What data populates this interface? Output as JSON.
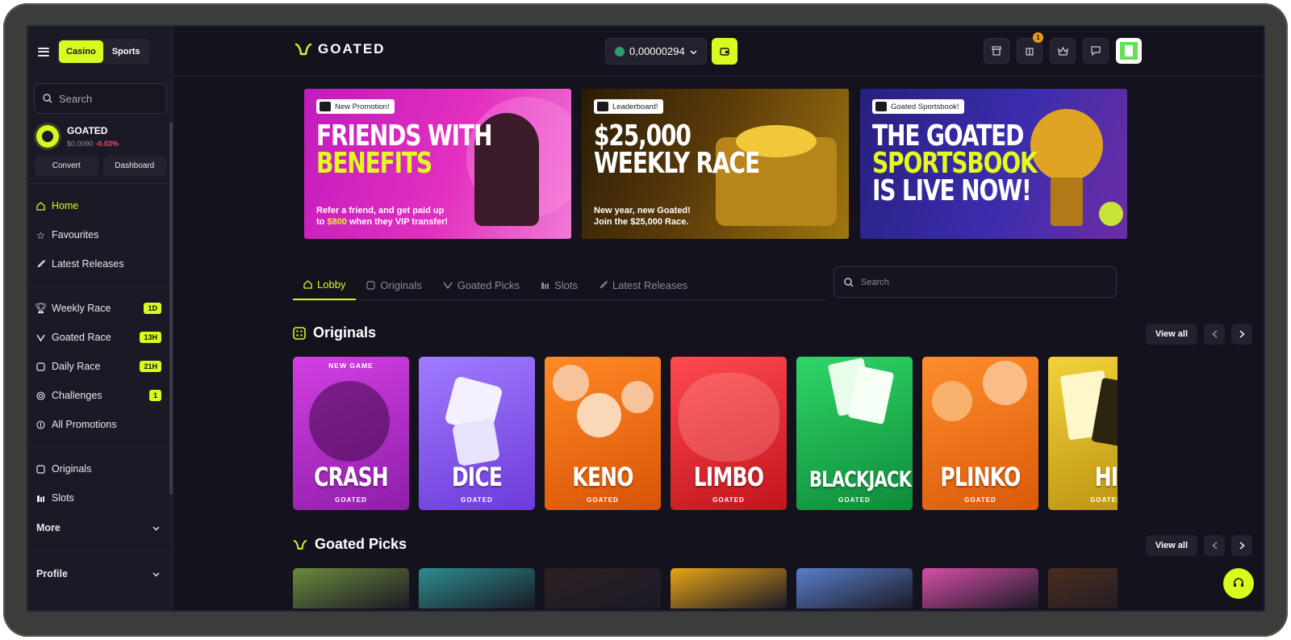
{
  "app": {
    "brand": "GOATED"
  },
  "sidebar": {
    "modes": [
      "Casino",
      "Sports"
    ],
    "search_placeholder": "Search",
    "token": {
      "name": "GOATED",
      "price": "$0.0090",
      "change": "-0.03%"
    },
    "token_actions": [
      "Convert",
      "Dashboard"
    ],
    "nav_main": [
      {
        "label": "Home",
        "icon": "home-icon"
      },
      {
        "label": "Favourites",
        "icon": "star-icon"
      },
      {
        "label": "Latest Releases",
        "icon": "rocket-icon"
      }
    ],
    "nav_races": [
      {
        "label": "Weekly Race",
        "badge": "1D",
        "icon": "trophy-icon"
      },
      {
        "label": "Goated Race",
        "badge": "13H",
        "icon": "goated-logo-icon"
      },
      {
        "label": "Daily Race",
        "badge": "21H",
        "icon": "square-icon"
      },
      {
        "label": "Challenges",
        "badge": "1",
        "icon": "target-icon"
      },
      {
        "label": "All Promotions",
        "badge": "",
        "icon": "coin-icon"
      }
    ],
    "nav_games": [
      {
        "label": "Originals",
        "icon": "square-icon"
      },
      {
        "label": "Slots",
        "icon": "slots-icon"
      }
    ],
    "more_label": "More",
    "profile_label": "Profile"
  },
  "header": {
    "balance": "0,00000294",
    "notification_count": "1"
  },
  "banners": [
    {
      "tag": "New Promotion!",
      "head_line1": "FRIENDS WITH",
      "head_line2": "BENEFITS",
      "sub_line1": "Refer a friend, and get paid up",
      "sub_pre": "to ",
      "sub_amount": "$800",
      "sub_post": " when they VIP transfer!"
    },
    {
      "tag": "Leaderboard!",
      "head_line1": "$25,000",
      "head_line2": "WEEKLY RACE",
      "sub_line1": "New year, new Goated!",
      "sub_line2": "Join the $25,000 Race."
    },
    {
      "tag": "Goated Sportsbook!",
      "head_line1": "THE GOATED",
      "head_line2": "SPORTSBOOK",
      "head_line3": "IS LIVE NOW!"
    }
  ],
  "tabs": [
    {
      "label": "Lobby",
      "icon": "home-icon"
    },
    {
      "label": "Originals",
      "icon": "square-icon"
    },
    {
      "label": "Goated Picks",
      "icon": "goated-logo-icon"
    },
    {
      "label": "Slots",
      "icon": "slots-icon"
    },
    {
      "label": "Latest Releases",
      "icon": "rocket-icon"
    }
  ],
  "main_search_placeholder": "Search",
  "originals": {
    "title": "Originals",
    "view_all": "View all",
    "new_tag": "NEW GAME",
    "brand": "GOATED",
    "games": [
      {
        "name": "CRASH",
        "color": "#b52ad2"
      },
      {
        "name": "DICE",
        "color": "#8a5cf0"
      },
      {
        "name": "KENO",
        "color": "#f26f12"
      },
      {
        "name": "LIMBO",
        "color": "#e7272e"
      },
      {
        "name": "BLACKJACK",
        "color": "#16b24e"
      },
      {
        "name": "PLINKO",
        "color": "#f27014"
      },
      {
        "name": "HI",
        "color": "#e0b81b"
      }
    ]
  },
  "goated_picks": {
    "title": "Goated Picks",
    "view_all": "View all",
    "thumb_colors": [
      "#6b8a3c",
      "#2d8d8f",
      "#2d1f24",
      "#e8a517",
      "#5a7fcb",
      "#d84fa8",
      "#4a2d1d"
    ]
  }
}
